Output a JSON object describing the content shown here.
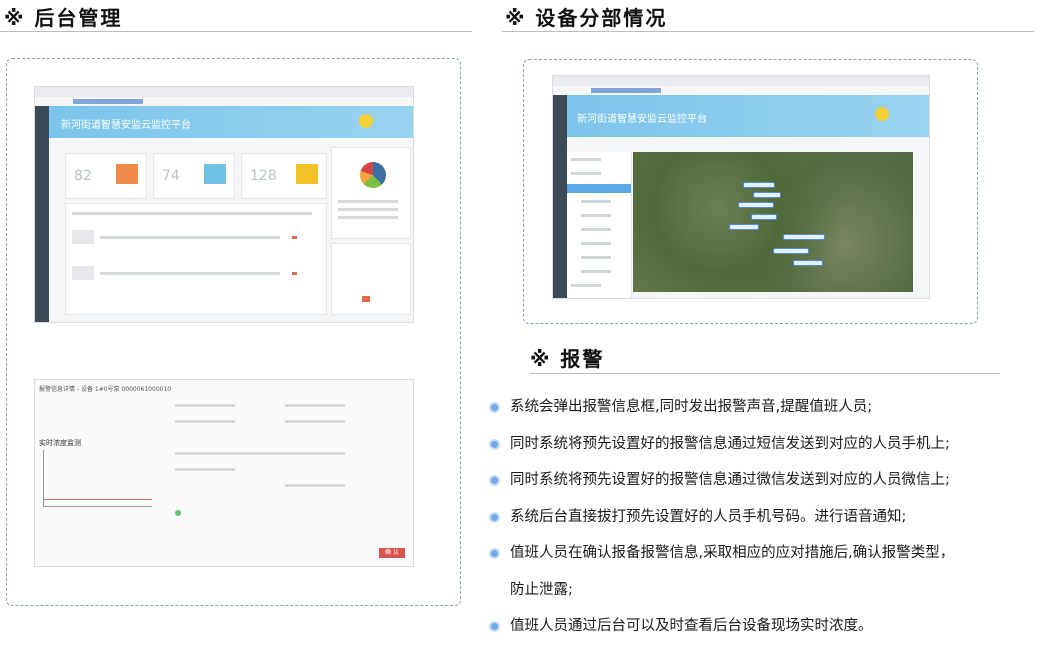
{
  "sections": {
    "backend_title": "※ 后台管理",
    "equipment_title": "※ 设备分部情况",
    "alarm_title": "※ 报警"
  },
  "screenshot1": {
    "platform_title": "新河街道智慧安监云监控平台",
    "numbers": [
      "82",
      "74",
      "128"
    ]
  },
  "screenshot2": {
    "dialog_title": "报警信息详情 - 设备 1#0号泵 0000061000010",
    "chart_title": "实时浓度监测",
    "confirm_button": "确 认"
  },
  "screenshot3": {
    "platform_title": "新河街道智慧安监云监控平台"
  },
  "alarm_items": [
    "系统会弹出报警信息框,同时发出报警声音,提醒值班人员;",
    "同时系统将预先设置好的报警信息通过短信发送到对应的人员手机上;",
    "同时系统将预先设置好的报警信息通过微信发送到对应的人员微信上;",
    "系统后台直接拔打预先设置好的人员手机号码。进行语音通知;",
    "值班人员在确认报备报警信息,采取相应的应对措施后,确认报警类型，",
    "防止泄露;",
    "值班人员通过后台可以及时查看后台设备现场实时浓度。"
  ],
  "colors": {
    "accent_blue": "#6fa8e8",
    "banner_blue": "#7cc4ea",
    "dashed_border": "#8ea0c8"
  }
}
